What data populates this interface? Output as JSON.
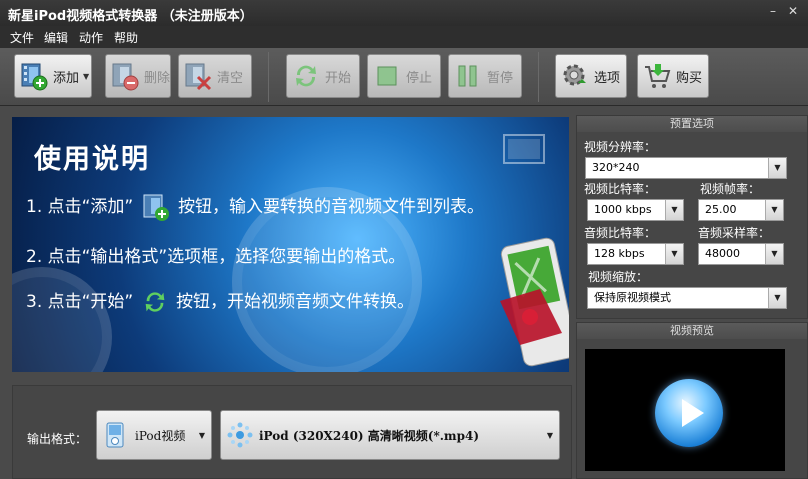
{
  "window": {
    "title": "新星iPod视频格式转换器 （未注册版本）"
  },
  "menu": [
    "文件",
    "编辑",
    "动作",
    "帮助"
  ],
  "toolbar": {
    "add": "添加",
    "delete": "删除",
    "clear": "清空",
    "start": "开始",
    "stop": "停止",
    "pause": "暂停",
    "options": "选项",
    "buy": "购买"
  },
  "banner": {
    "title": "使用说明",
    "step1_a": "1. 点击“添加”",
    "step1_b": "按钮，输入要转换的音视频文件到列表。",
    "step2": "2. 点击“输出格式”选项框，选择您要输出的格式。",
    "step3_a": "3. 点击“开始”",
    "step3_b": "按钮，开始视频音频文件转换。"
  },
  "output": {
    "label": "输出格式：",
    "device": "iPod视频",
    "format": "iPod (320X240) 高清晰视频(*.mp4)"
  },
  "presets": {
    "header": "预置选项",
    "resolution_label": "视频分辨率：",
    "resolution": "320*240",
    "video_bitrate_label": "视频比特率：",
    "video_bitrate": "1000 kbps",
    "framerate_label": "视频帧率：",
    "framerate": "25.00",
    "audio_bitrate_label": "音频比特率：",
    "audio_bitrate": "128 kbps",
    "samplerate_label": "音频采样率：",
    "samplerate": "48000",
    "scale_label": "视频缩放：",
    "scale": "保持原视频模式"
  },
  "preview": {
    "header": "视频预览"
  },
  "colors": {
    "accent": "#2a8fe0",
    "banner": "#0d3b7a",
    "green": "#3cb63c"
  }
}
